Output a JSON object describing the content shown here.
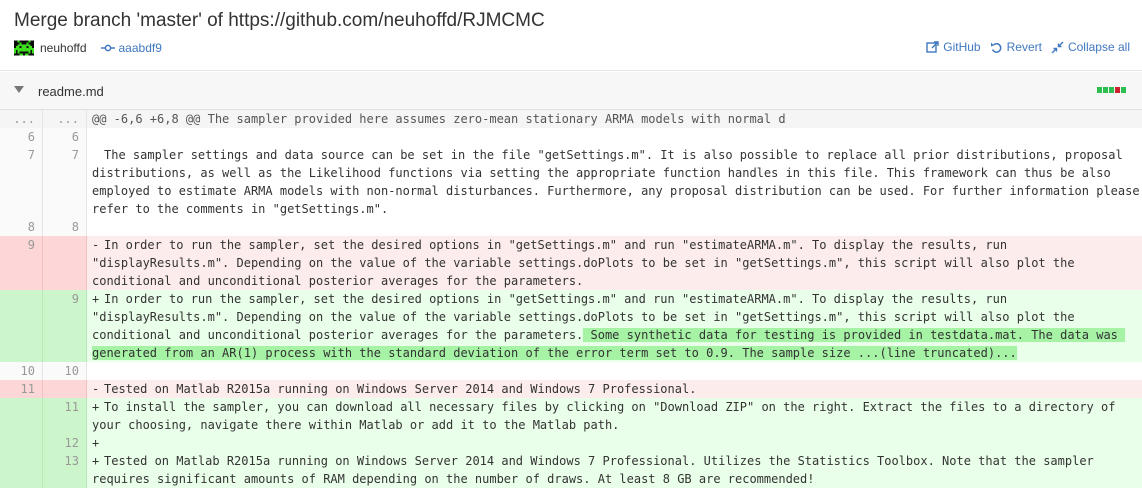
{
  "commit": {
    "title": "Merge branch 'master' of https://github.com/neuhoffd/RJMCMC",
    "author": "neuhoffd",
    "sha": "aaabdf9"
  },
  "actions": {
    "github": "GitHub",
    "revert": "Revert",
    "collapse": "Collapse all"
  },
  "file": {
    "name": "readme.md"
  },
  "colors": {
    "link": "#4078c0",
    "deleted_bg": "#fdecec",
    "added_bg": "#eaffea",
    "added_highlight": "#a6f3a6",
    "diffstat_add": "#2cbe4e",
    "diffstat_del": "#cb2431"
  },
  "icons": {
    "avatar": "space-invader-avatar",
    "sha": "commit-icon",
    "github": "external-link-icon",
    "revert": "undo-icon",
    "collapse": "collapse-icon",
    "toggle": "chevron-down-icon"
  },
  "diff": {
    "hunk": {
      "left": "...",
      "right": "...",
      "text": "@@ -6,6 +6,8 @@ The sampler provided here assumes zero-mean stationary ARMA models with normal d"
    },
    "rows": [
      {
        "left": "6",
        "right": "6",
        "marker": "",
        "text": ""
      },
      {
        "left": "7",
        "right": "7",
        "marker": "",
        "text": "The sampler settings and data source can be set in the file \"getSettings.m\". It is also possible to replace all prior distributions, proposal distributions, as well as the Likelihood functions via setting the appropriate function handles in this file. This framework can thus be also employed to estimate ARMA models with non-normal disturbances. Furthermore, any proposal distribution can be used. For further information please refer to the comments in \"getSettings.m\"."
      },
      {
        "left": "8",
        "right": "8",
        "marker": "",
        "text": ""
      },
      {
        "left": "9",
        "right": "",
        "marker": "-",
        "text": "In order to run the sampler, set the desired options in \"getSettings.m\" and run \"estimateARMA.m\". To display the results, run \"displayResults.m\". Depending on the value of the variable settings.doPlots to be set in \"getSettings.m\", this script will also plot the conditional and unconditional posterior averages for the parameters."
      },
      {
        "left": "",
        "right": "9",
        "marker": "+",
        "text": "In order to run the sampler, set the desired options in \"getSettings.m\" and run \"estimateARMA.m\". To display the results, run \"displayResults.m\". Depending on the value of the variable settings.doPlots to be set in \"getSettings.m\", this script will also plot the conditional and unconditional posterior averages for the parameters.",
        "highlight": " Some synthetic data for testing is provided in testdata.mat. The data was generated from an AR(1) process with the standard deviation of the error term set to 0.9. The sample size ...(line truncated)..."
      },
      {
        "left": "10",
        "right": "10",
        "marker": "",
        "text": ""
      },
      {
        "left": "11",
        "right": "",
        "marker": "-",
        "text": "Tested on Matlab R2015a running on Windows Server 2014 and Windows 7 Professional."
      },
      {
        "left": "",
        "right": "11",
        "marker": "+",
        "text": "To install the sampler, you can download all necessary files by clicking on \"Download ZIP\" on the right. Extract the files to a directory of your choosing, navigate there within Matlab or add it to the Matlab path."
      },
      {
        "left": "",
        "right": "12",
        "marker": "+",
        "text": ""
      },
      {
        "left": "",
        "right": "13",
        "marker": "+",
        "text": "Tested on Matlab R2015a running on Windows Server 2014 and Windows 7 Professional. Utilizes the Statistics Toolbox. Note that the sampler requires significant amounts of RAM depending on the number of draws. At least 8 GB are recommended!"
      }
    ]
  }
}
